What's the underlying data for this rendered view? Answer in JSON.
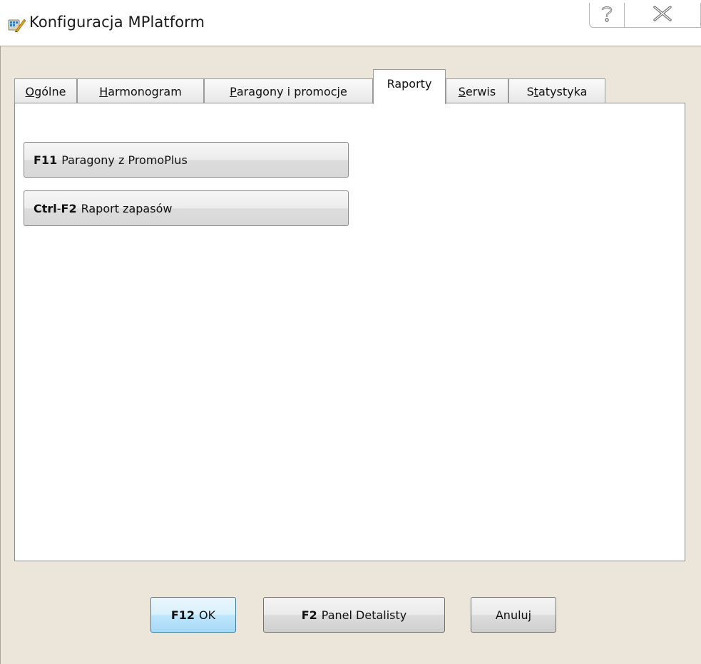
{
  "window": {
    "title": "Konfiguracja MPlatform",
    "help_icon": "help-icon",
    "close_icon": "close-icon",
    "app_icon": "app-icon"
  },
  "tabs": [
    {
      "label": "Ogólne",
      "accel": "O",
      "rest": "gólne",
      "active": false
    },
    {
      "label": "Harmonogram",
      "accel": "H",
      "rest": "armonogram",
      "active": false
    },
    {
      "label": "Paragony i promocje",
      "accel": "P",
      "rest": "aragony i promocje",
      "active": false
    },
    {
      "label": "Raporty",
      "accel": "",
      "rest": "Raporty",
      "active": true
    },
    {
      "label": "Serwis",
      "accel": "S",
      "rest": "erwis",
      "active": false
    },
    {
      "label": "Statystyka",
      "pre": "S",
      "accel": "t",
      "rest": "atystyka",
      "active": false
    }
  ],
  "reports": {
    "paragony": {
      "key": "F11",
      "label": "Paragony z PromoPlus"
    },
    "zapasy": {
      "key_part1": "Ctrl",
      "key_sep": "-",
      "key_part2": "F2",
      "label": "Raport zapasów"
    }
  },
  "footer": {
    "ok": {
      "key": "F12",
      "label": "OK"
    },
    "panel": {
      "key": "F2",
      "label": "Panel Detalisty"
    },
    "cancel": {
      "label": "Anuluj"
    }
  },
  "colors": {
    "dialog_bg": "#ece6da",
    "ok_accent": "#3c7fb1"
  }
}
